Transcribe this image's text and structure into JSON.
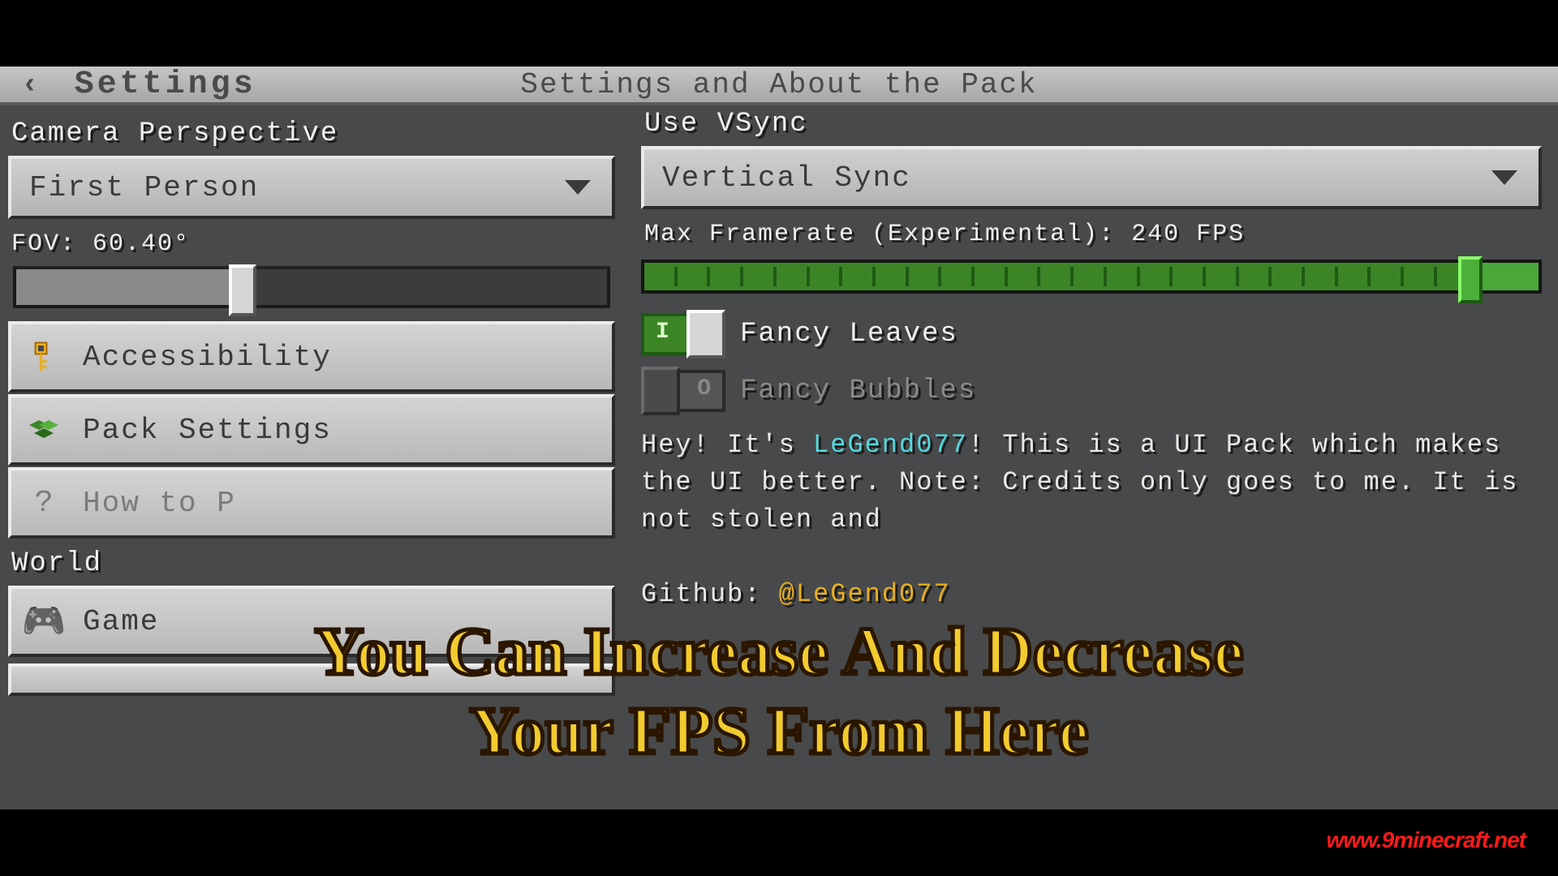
{
  "header": {
    "back_label": "Settings",
    "center_title": "Settings and About the Pack"
  },
  "left": {
    "camera_label": "Camera Perspective",
    "camera_value": "First Person",
    "fov_label": "FOV: 60.40°",
    "fov_percent": 37,
    "nav": {
      "accessibility": "Accessibility",
      "pack_settings": "Pack Settings",
      "how_to": "How to P",
      "world_label": "World",
      "game": "Game"
    }
  },
  "right": {
    "vsync_label": "Use VSync",
    "vsync_value": "Vertical Sync",
    "framerate_label": "Max Framerate (Experimental): 240 FPS",
    "framerate_percent": 92,
    "fancy_leaves": "Fancy Leaves",
    "fancy_bubbles": "Fancy Bubbles",
    "info": {
      "line1a": "Hey! It's ",
      "author": "LeGend077",
      "line1b": "! This is a UI Pack which makes the UI better. Note: Credits only goes to me. It is not stolen and",
      "github_label": "Github: ",
      "github_handle": "@LeGend077"
    }
  },
  "caption": {
    "line1": "You Can Increase And Decrease",
    "line2": "Your FPS From Here"
  },
  "watermark": "www.9minecraft.net",
  "chart_data": null
}
